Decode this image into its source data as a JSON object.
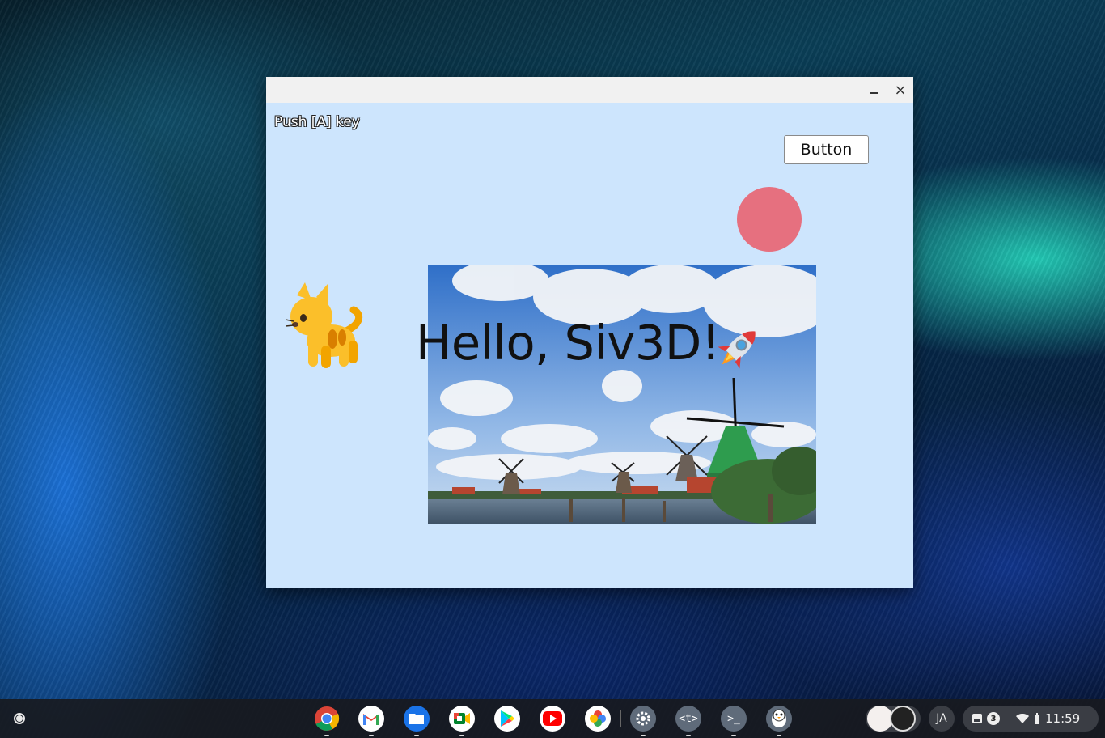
{
  "window": {
    "minimize_symbol": "",
    "close_symbol": "×"
  },
  "app": {
    "hint_text": "Push [A] key",
    "button_label": "Button",
    "hello_text": "Hello, Siv3D!",
    "circle_color": "#e6707f",
    "background_color": "#cde5fd",
    "emoji": [
      "cat-emoji",
      "rocket-emoji"
    ],
    "photo": "windmills-landscape"
  },
  "shelf": {
    "apps": [
      "chrome-icon",
      "gmail-icon",
      "files-icon",
      "meet-icon",
      "play-store-icon",
      "youtube-icon",
      "photos-icon",
      "settings-icon",
      "text-editor-icon",
      "terminal-icon",
      "penguin-icon"
    ],
    "ime_label": "JA",
    "notification_count": "3",
    "time": "11:59"
  }
}
